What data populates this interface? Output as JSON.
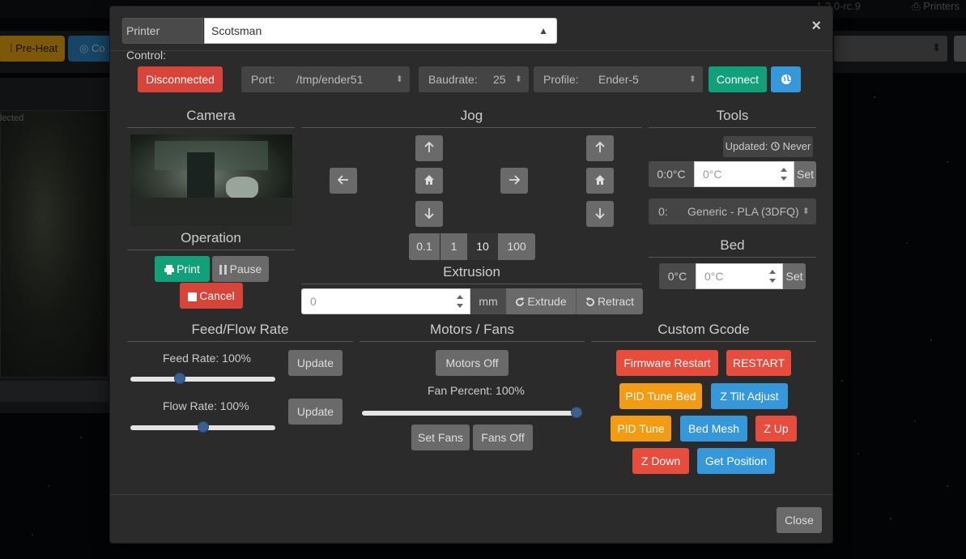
{
  "background": {
    "version": "1.2.0-rc.9",
    "printers_link": "Printers",
    "preheat_button": "Pre-Heat",
    "connect_button_partial": "Co",
    "camera_label": "lected"
  },
  "header": {
    "printer_control_label": "Printer Control:",
    "printer_selected": "Scotsman"
  },
  "connection": {
    "status": "Disconnected",
    "port_label": "Port:",
    "port_value": "/tmp/ender51",
    "baud_label": "Baudrate:",
    "baud_value": "25",
    "profile_label": "Profile:",
    "profile_value": "Ender-5",
    "connect_label": "Connect"
  },
  "camera": {
    "title": "Camera"
  },
  "operation": {
    "title": "Operation",
    "print_label": "Print",
    "pause_label": "Pause",
    "cancel_label": "Cancel"
  },
  "jog": {
    "title": "Jog",
    "steps": [
      "0.1",
      "1",
      "10",
      "100"
    ],
    "active_step": "10"
  },
  "extrusion": {
    "title": "Extrusion",
    "amount": "0",
    "unit": "mm",
    "extrude_label": "Extrude",
    "retract_label": "Retract"
  },
  "tools": {
    "title": "Tools",
    "updated_label": "Updated:",
    "updated_value": "Never",
    "tool_temp": "0:0°C",
    "tool_placeholder": "0°C",
    "set_label": "Set",
    "filament_index": "0:",
    "filament_value": "Generic - PLA (3DFQ)"
  },
  "bed": {
    "title": "Bed",
    "temp": "0°C",
    "placeholder": "0°C",
    "set_label": "Set"
  },
  "feed_flow": {
    "title": "Feed/Flow Rate",
    "feed_label": "Feed Rate: 100%",
    "flow_label": "Flow Rate: 100%",
    "update_label": "Update",
    "feed_value": 0.33,
    "flow_value": 0.5
  },
  "motors": {
    "title": "Motors / Fans",
    "motors_off": "Motors Off",
    "fan_label": "Fan Percent: 100%",
    "fan_value": 1.0,
    "set_fans": "Set Fans",
    "fans_off": "Fans Off"
  },
  "gcode": {
    "title": "Custom Gcode",
    "buttons": [
      {
        "label": "Firmware Restart",
        "color": "#e74c3c"
      },
      {
        "label": "RESTART",
        "color": "#e74c3c"
      },
      {
        "label": "PID Tune Bed",
        "color": "#f39c12"
      },
      {
        "label": "Z Tilt Adjust",
        "color": "#3498db"
      },
      {
        "label": "PID Tune",
        "color": "#f39c12"
      },
      {
        "label": "Bed Mesh",
        "color": "#3498db"
      },
      {
        "label": "Z Up",
        "color": "#e74c3c"
      },
      {
        "label": "Z Down",
        "color": "#e74c3c"
      },
      {
        "label": "Get Position",
        "color": "#3498db"
      }
    ]
  },
  "footer": {
    "close_label": "Close"
  }
}
